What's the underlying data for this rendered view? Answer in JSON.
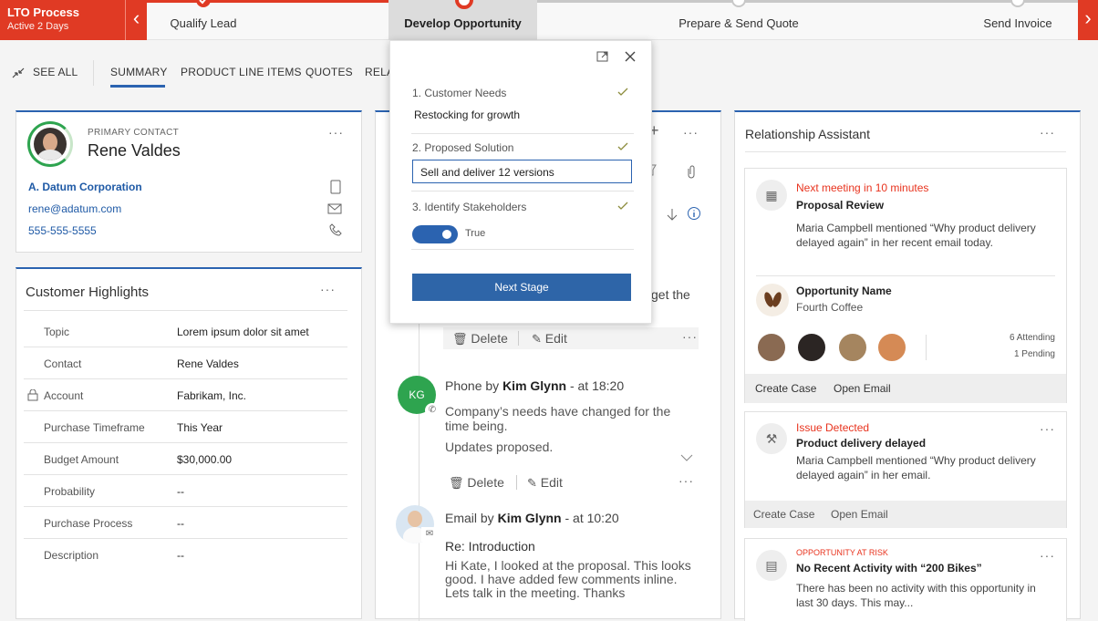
{
  "process": {
    "title": "LTO Process",
    "subtitle": "Active 2 Days",
    "stages": [
      "Qualify Lead",
      "Develop Opportunity",
      "Prepare & Send Quote",
      "Send Invoice"
    ]
  },
  "tabs": {
    "see_all": "SEE ALL",
    "items": [
      "SUMMARY",
      "PRODUCT LINE ITEMS",
      "QUOTES",
      "RELA"
    ]
  },
  "contact": {
    "label": "PRIMARY CONTACT",
    "name": "Rene Valdes",
    "company": "A. Datum Corporation",
    "email": "rene@adatum.com",
    "phone": "555-555-5555",
    "more": "···"
  },
  "highlights": {
    "title": "Customer Highlights",
    "more": "···",
    "rows": [
      {
        "k": "Topic",
        "v": "Lorem ipsum dolor sit amet"
      },
      {
        "k": "Contact",
        "v": "Rene Valdes"
      },
      {
        "k": "Account",
        "v": "Fabrikam, Inc."
      },
      {
        "k": "Purchase Timeframe",
        "v": "This Year"
      },
      {
        "k": "Budget Amount",
        "v": "$30,000.00"
      },
      {
        "k": "Probability",
        "v": "--"
      },
      {
        "k": "Purchase Process",
        "v": "--"
      },
      {
        "k": "Description",
        "v": "--"
      }
    ]
  },
  "flyout": {
    "steps": [
      {
        "label": "1. Customer Needs",
        "value": "Restocking for growth"
      },
      {
        "label": "2. Proposed Solution",
        "value": "Sell and deliver 12 versions"
      },
      {
        "label": "3. Identify Stakeholders",
        "value": "True"
      }
    ],
    "next_stage": "Next Stage"
  },
  "timeline": {
    "partial_text": "get the",
    "delete": "Delete",
    "edit": "Edit",
    "items": [
      {
        "initials": "KG",
        "title_pre": "Phone by ",
        "author": "Kim Glynn",
        "time": " - at 18:20",
        "body1": "Company’s needs have changed for the time being.",
        "body2": "Updates proposed."
      },
      {
        "title_pre": "Email by ",
        "author": "Kim Glynn",
        "time": " - at 10:20",
        "subject": "Re: Introduction",
        "body1": "Hi Kate, I looked at the proposal. This looks good. I have added few comments inline. Lets talk in the meeting. Thanks"
      }
    ]
  },
  "assistant": {
    "title": "Relationship Assistant",
    "more": "···",
    "card1": {
      "flag": "Next meeting in 10 minutes",
      "title": "Proposal Review",
      "body": "Maria Campbell mentioned “Why product delivery delayed again” in her recent email today.",
      "opp_title": "Opportunity Name",
      "opp_sub": "Fourth Coffee",
      "attending": "6 Attending",
      "pending": "1 Pending",
      "action1": "Create Case",
      "action2": "Open Email"
    },
    "card2": {
      "flag": "Issue Detected",
      "title": "Product delivery delayed",
      "body": "Maria Campbell mentioned “Why product delivery delayed again” in her email.",
      "action1": "Create Case",
      "action2": "Open Email"
    },
    "card3": {
      "flag": "OPPORTUNITY AT RISK",
      "title": "No Recent Activity with “200 Bikes”",
      "body": "There has been no activity with this opportunity in last 30 days. This may..."
    }
  },
  "colors": {
    "brand_red": "#e03a24",
    "accent_blue": "#2b63b0",
    "alert_red": "#e8331e",
    "green": "#2ea44f"
  }
}
